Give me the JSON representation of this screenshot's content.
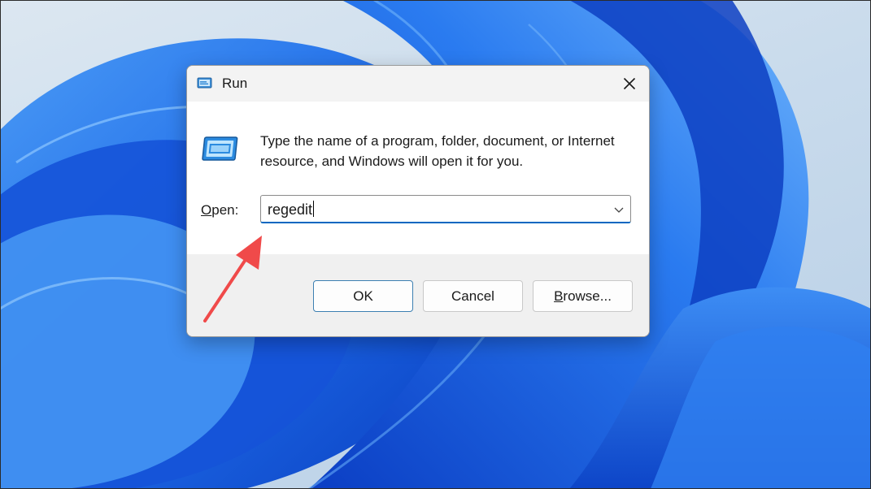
{
  "dialog": {
    "title": "Run",
    "description": "Type the name of a program, folder, document, or Internet resource, and Windows will open it for you.",
    "open_label_mnemonic": "O",
    "open_label_rest": "pen:",
    "input_value": "regedit",
    "buttons": {
      "ok": "OK",
      "cancel": "Cancel",
      "browse_mnemonic": "B",
      "browse_rest": "rowse..."
    }
  },
  "icons": {
    "title": "run-icon",
    "close": "close-icon",
    "app": "run-app-icon",
    "dropdown": "chevron-down-icon"
  },
  "colors": {
    "accent": "#0067c0",
    "annotation_arrow": "#f04a4a",
    "wallpaper_blue": "#1a5fe0"
  }
}
